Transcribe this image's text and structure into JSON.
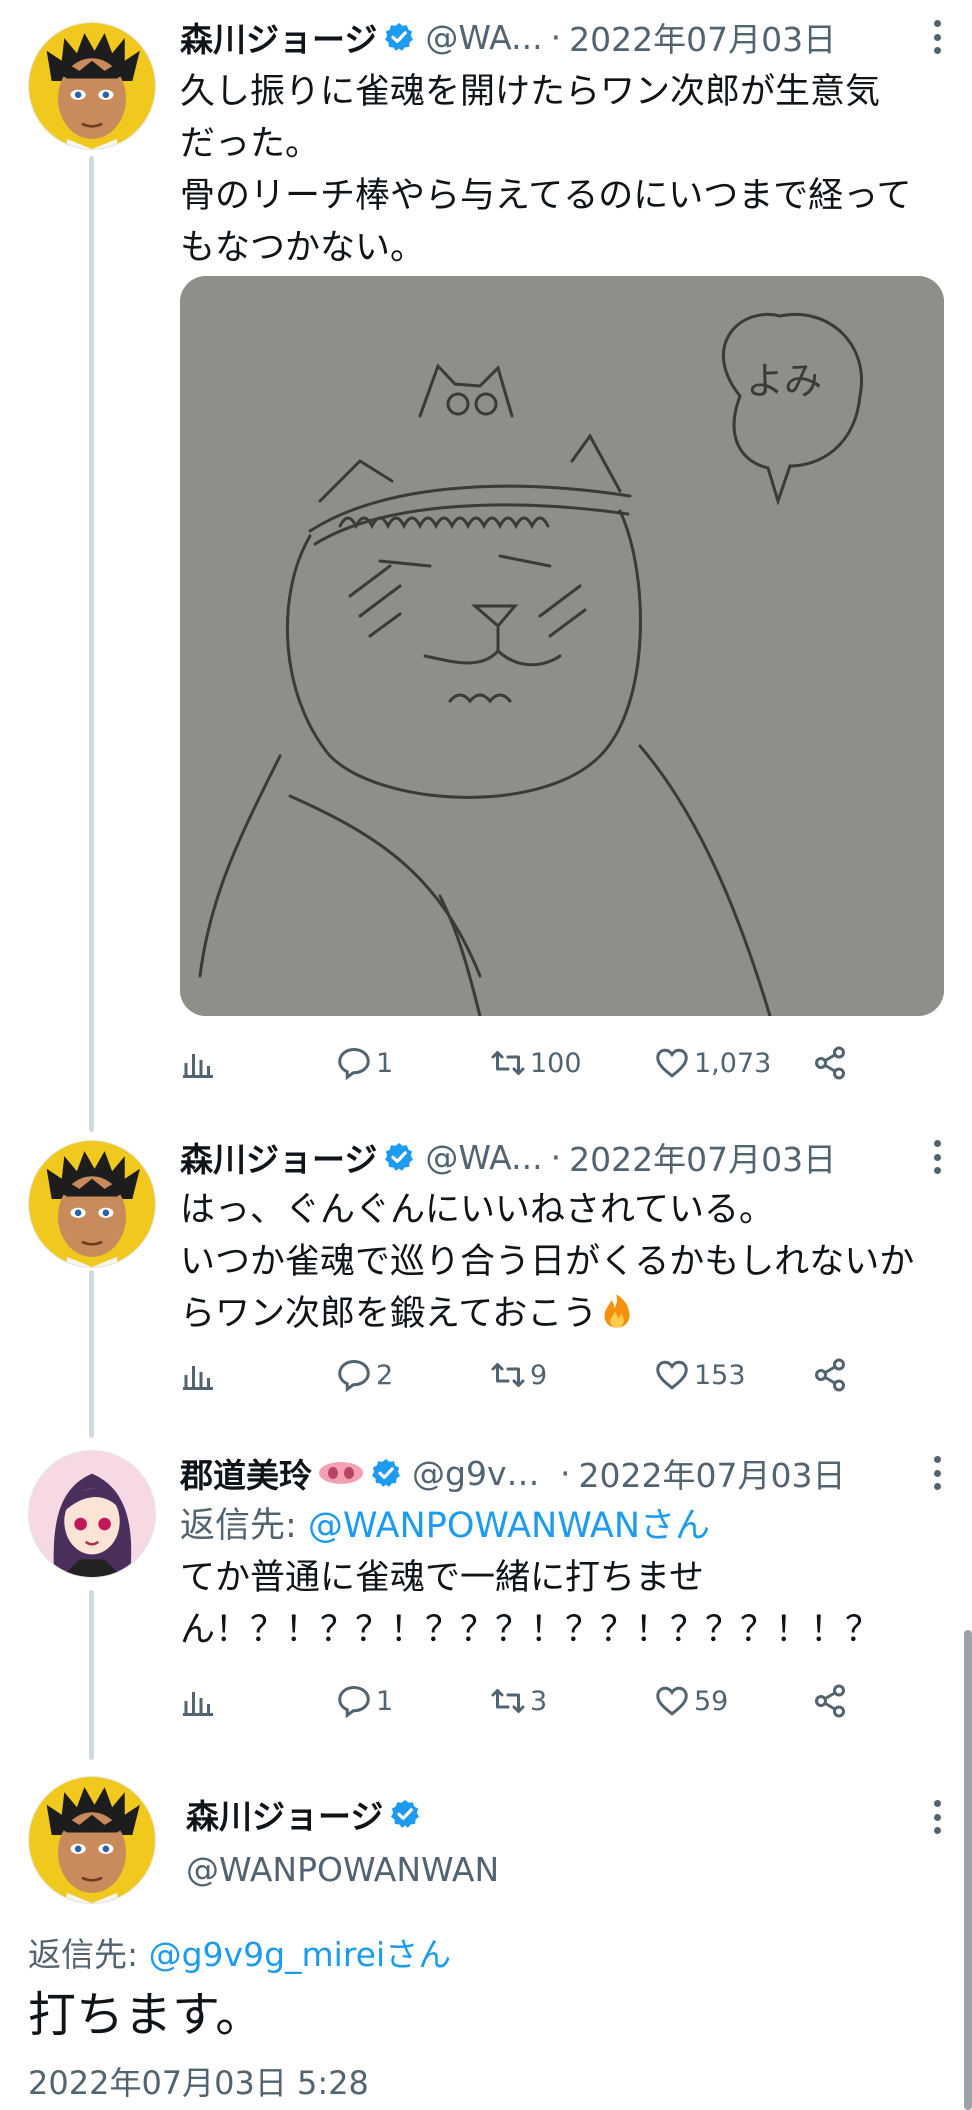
{
  "colors": {
    "accent": "#1d9bf0",
    "muted": "#536471",
    "text": "#0f1419"
  },
  "tweets": [
    {
      "author_name": "森川ジョージ",
      "handle": "@WA...",
      "separator": "·",
      "date": "2022年07月03日",
      "text_lines": [
        "久し振りに雀魂を開けたらワン次郎が生意気",
        "だった。",
        "骨のリーチ棒やら与えてるのにいつまで経って",
        "もなつかない。"
      ],
      "image_caption": "よみ",
      "stats": {
        "replies": "1",
        "retweets": "100",
        "likes": "1,073"
      }
    },
    {
      "author_name": "森川ジョージ",
      "handle": "@WA...",
      "separator": "·",
      "date": "2022年07月03日",
      "text_lines": [
        "はっ、ぐんぐんにいいねされている。",
        "いつか雀魂で巡り合う日がくるかもしれないか",
        "らワン次郎を鍛えておこう"
      ],
      "emoji": "fire-icon",
      "stats": {
        "replies": "2",
        "retweets": "9",
        "likes": "153"
      }
    },
    {
      "author_name": "郡道美玲",
      "handle": "@g9v9...",
      "separator": "·",
      "date": "2022年07月03日",
      "reply_to_label": "返信先: ",
      "reply_to_target": "@WANPOWANWANさん",
      "text_lines": [
        "てか普通に雀魂で一緒に打ちませ",
        "ん！？！？？！？？？！？？！？？？！！？"
      ],
      "stats": {
        "replies": "1",
        "retweets": "3",
        "likes": "59"
      }
    }
  ],
  "focus": {
    "author_name": "森川ジョージ",
    "handle": "@WANPOWANWAN",
    "reply_to_label": "返信先: ",
    "reply_to_target": "@g9v9g_mireiさん",
    "text": "打ちます。",
    "timestamp": "2022年07月03日 5:28"
  }
}
